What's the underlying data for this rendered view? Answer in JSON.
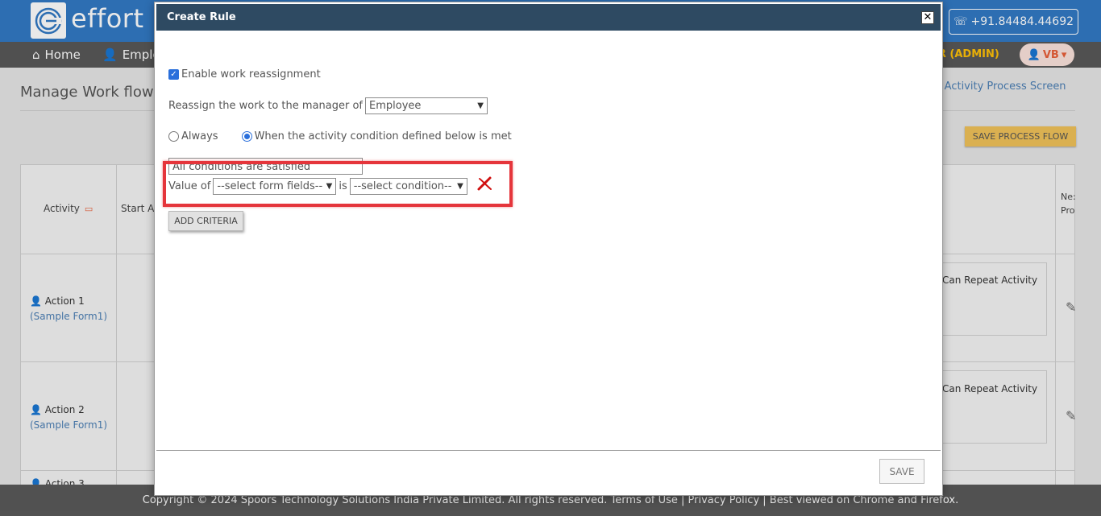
{
  "app": {
    "logo_text": "effort",
    "phone": "+91.84484.44692",
    "nav_home": "Home",
    "nav_employees": "Emplo",
    "role_label": "ER (ADMIN)",
    "user_initials": "VB"
  },
  "page": {
    "title": "Manage Work flow",
    "crumb_link": "k Activity Process Screen",
    "save_process_flow": "SAVE PROCESS FLOW",
    "table": {
      "col_activity": "Activity",
      "col_start": "Start A",
      "col_next_1": "Ne:",
      "col_next_2": "Pro",
      "rows": [
        {
          "name": "Action 1",
          "form": "(Sample Form1)",
          "repeat": "Can Repeat Activity"
        },
        {
          "name": "Action 2",
          "form": "(Sample Form1)",
          "repeat": "Can Repeat Activity"
        },
        {
          "name": "Action 3"
        }
      ]
    }
  },
  "footer": {
    "text": "Copyright © 2024 Spoors Technology Solutions India Private Limited. All rights reserved. Terms of Use | Privacy Policy | Best viewed on Chrome and Firefox."
  },
  "modal": {
    "title": "Create Rule",
    "close_symbol": "✕",
    "enable_label": "Enable work reassignment",
    "enable_checked": true,
    "reassign_label": "Reassign the work to the manager of",
    "reassign_value": "Employee",
    "radio_always": "Always",
    "radio_condition": "When the activity condition defined below is met",
    "selected_radio": "condition",
    "conditions_select": "All conditions are satisfied",
    "criteria": {
      "value_of_label": "Value of",
      "field_select": "--select form fields--",
      "is_label": "is",
      "condition_select": "--select condition--"
    },
    "add_criteria": "ADD CRITERIA",
    "save": "SAVE",
    "highlight_color": "#e5353b"
  }
}
